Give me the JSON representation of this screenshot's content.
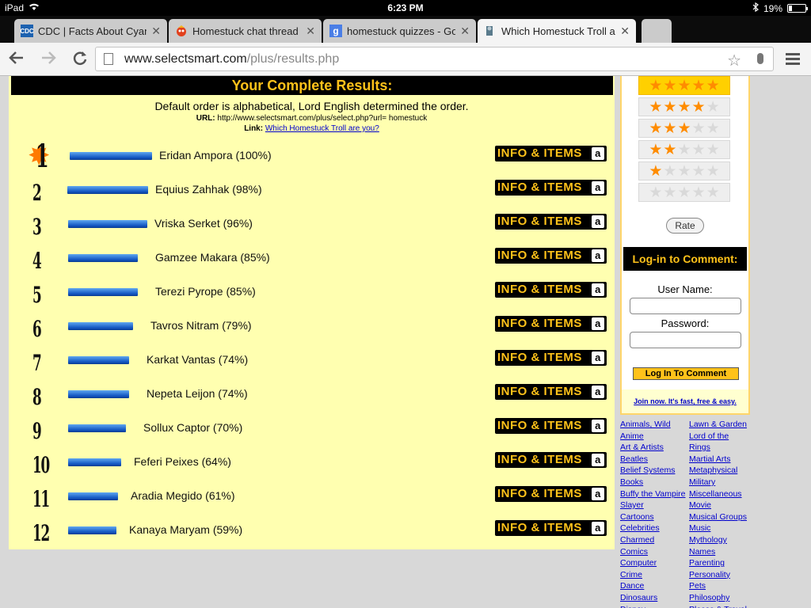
{
  "statusbar": {
    "device": "iPad",
    "time": "6:23 PM",
    "battery": "19%"
  },
  "tabs": [
    {
      "title": "CDC | Facts About Cyanid",
      "favicon": "cdc-icon"
    },
    {
      "title": "Homestuck chat thread",
      "favicon": "homestuck-icon"
    },
    {
      "title": "homestuck quizzes - Goog",
      "favicon": "google-icon"
    },
    {
      "title": "Which Homestuck Troll ar",
      "favicon": "selectsmart-icon"
    }
  ],
  "omnibox": {
    "host": "www.selectsmart.com",
    "path": "/plus/results.php"
  },
  "results": {
    "header": "Your Complete Results:",
    "order_note": "Default order is alphabetical, Lord English determined the order.",
    "url_label": "URL:",
    "url_value": "http://www.selectsmart.com/plus/select.php?url= homestuck",
    "link_label": "Link:",
    "link_text": "Which Homestuck Troll are you?",
    "info_button": "INFO & ITEMS",
    "amazon_glyph": "a",
    "items": [
      {
        "rank": "1",
        "name": "Eridan Ampora (100%)",
        "pct": 100
      },
      {
        "rank": "2",
        "name": "Equius Zahhak (98%)",
        "pct": 98
      },
      {
        "rank": "3",
        "name": "Vriska Serket (96%)",
        "pct": 96
      },
      {
        "rank": "4",
        "name": "Gamzee Makara (85%)",
        "pct": 85
      },
      {
        "rank": "5",
        "name": "Terezi Pyrope (85%)",
        "pct": 85
      },
      {
        "rank": "6",
        "name": "Tavros Nitram (79%)",
        "pct": 79
      },
      {
        "rank": "7",
        "name": "Karkat Vantas (74%)",
        "pct": 74
      },
      {
        "rank": "8",
        "name": "Nepeta Leijon (74%)",
        "pct": 74
      },
      {
        "rank": "9",
        "name": "Sollux Captor (70%)",
        "pct": 70
      },
      {
        "rank": "10",
        "name": "Feferi Peixes (64%)",
        "pct": 64
      },
      {
        "rank": "11",
        "name": "Aradia Megido (61%)",
        "pct": 61
      },
      {
        "rank": "12",
        "name": "Kanaya Maryam (59%)",
        "pct": 59
      }
    ]
  },
  "rating": {
    "rows": [
      5,
      4,
      3,
      2,
      1,
      0
    ],
    "selected_index": 0,
    "rate_button": "Rate"
  },
  "login": {
    "header": "Log-in to Comment:",
    "username_label": "User Name:",
    "password_label": "Password:",
    "button": "Log In To Comment",
    "join_text": "Join now. It's fast, free & easy."
  },
  "categories": {
    "left": [
      "Animals, Wild",
      "Anime",
      "Art & Artists",
      "Beatles",
      "Belief Systems",
      "Books",
      "Buffy the Vampire",
      "Slayer",
      "Cartoons",
      "Celebrities",
      "Charmed",
      "Comics",
      "Computer",
      "Crime",
      "Dance",
      "Dinosaurs",
      "Disney"
    ],
    "right": [
      "Lawn & Garden",
      "Lord of the",
      "Rings",
      "Martial Arts",
      "Metaphysical",
      "Military",
      "Miscellaneous",
      "Movie",
      "Musical Groups",
      "Music",
      "Mythology",
      "Names",
      "Parenting",
      "Personality",
      "Pets",
      "Philosophy",
      "Places & Travel"
    ]
  },
  "colors": {
    "accent_yellow": "#ffc21a",
    "panel_bg": "#ffffb0",
    "bar_blue": "#1356c2"
  }
}
